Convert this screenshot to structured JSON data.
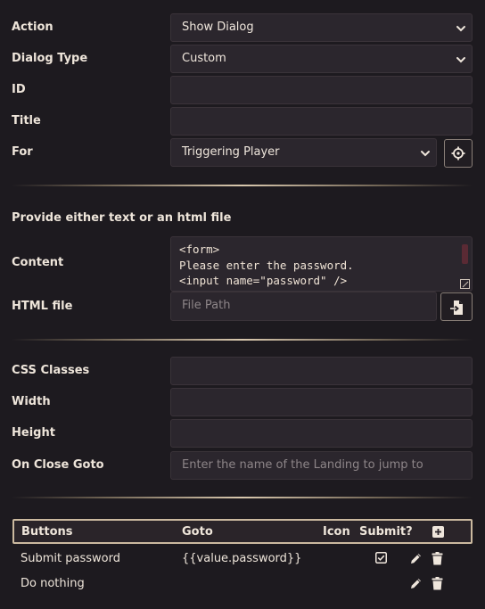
{
  "form": {
    "action": {
      "label": "Action",
      "value": "Show Dialog"
    },
    "dialog_type": {
      "label": "Dialog Type",
      "value": "Custom"
    },
    "id": {
      "label": "ID",
      "value": ""
    },
    "title": {
      "label": "Title",
      "value": ""
    },
    "for": {
      "label": "For",
      "value": "Triggering Player",
      "target_icon": "crosshair-icon"
    }
  },
  "content_section": {
    "heading": "Provide either text or an html file",
    "content": {
      "label": "Content",
      "lines": [
        "<form>",
        "Please enter the password.",
        "<input name=\"password\" />"
      ]
    },
    "html_file": {
      "label": "HTML file",
      "placeholder": "File Path",
      "browse_icon": "file-import-icon"
    }
  },
  "style_section": {
    "css_classes": {
      "label": "CSS Classes",
      "value": ""
    },
    "width": {
      "label": "Width",
      "value": ""
    },
    "height": {
      "label": "Height",
      "value": ""
    },
    "on_close_goto": {
      "label": "On Close Goto",
      "placeholder": "Enter the name of the Landing to jump to"
    }
  },
  "buttons_table": {
    "headers": {
      "buttons": "Buttons",
      "goto": "Goto",
      "icon": "Icon",
      "submit": "Submit?"
    },
    "add_icon": "plus-icon",
    "rows": [
      {
        "name": "Submit password",
        "goto": "{{value.password}}",
        "icon": "",
        "submit": true
      },
      {
        "name": "Do nothing",
        "goto": "",
        "icon": "",
        "submit": false
      }
    ]
  },
  "colors": {
    "background": "#1d1a1f",
    "field": "#2b262d",
    "text": "#eee5da",
    "divider_highlight": "#d9c8ae",
    "scroll_thumb": "#5a2a34"
  }
}
